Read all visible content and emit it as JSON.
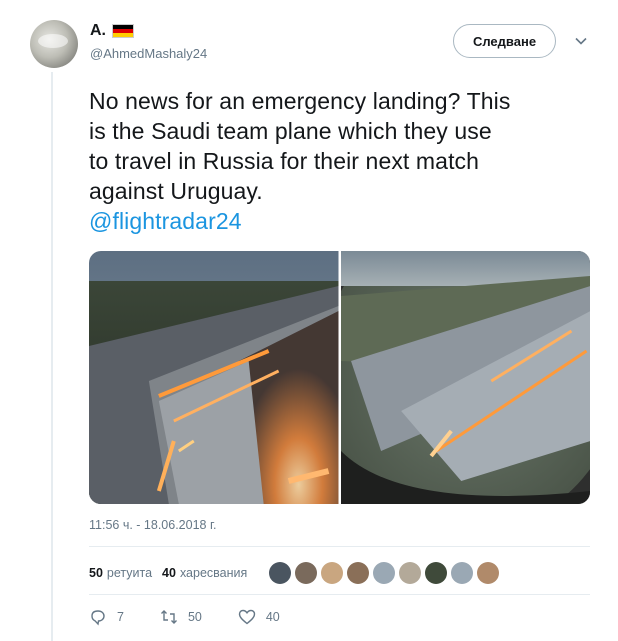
{
  "author": {
    "display_name": "A.",
    "handle": "@AhmedMashaly24",
    "avatar_icon": "avatar-photo",
    "flag_icon": "germany-flag-icon",
    "flag_colors": [
      "#000000",
      "#dd0000",
      "#ffce00"
    ]
  },
  "header": {
    "follow_label": "Следване",
    "more_icon": "chevron-down-icon"
  },
  "tweet": {
    "text_lines": [
      "No news for an emergency landing? This",
      "is the Saudi team plane which they use",
      "to travel in Russia for their next match",
      "against Uruguay."
    ],
    "mention": "@flightradar24",
    "mention_color": "#1b95e0",
    "timestamp": "11:56 ч. - 18.06.2018 г."
  },
  "stats": {
    "retweets_count": "50",
    "retweets_label": "ретуита",
    "likes_count": "40",
    "likes_label": "харесвания",
    "liker_avatars": [
      "#4a5560",
      "#7a6a5c",
      "#c9a680",
      "#8a6f58",
      "#9aa8b4",
      "#b3a999",
      "#3f4a3a",
      "#9aa8b4",
      "#b08a6a"
    ]
  },
  "actions": {
    "reply_count": "7",
    "retweet_count": "50",
    "like_count": "40"
  }
}
